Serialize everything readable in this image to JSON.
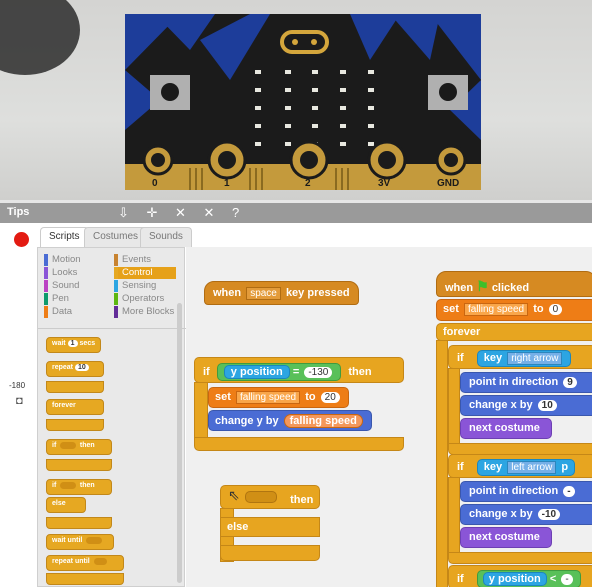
{
  "photo": {
    "board_pins": [
      "0",
      "1",
      "2",
      "3V",
      "GND"
    ],
    "colors": {
      "board_blue": "#1d3d9a",
      "board_black": "#1a1a1a",
      "pad_gold": "#c49a3c",
      "led": "#e8e8e0"
    }
  },
  "toolbar": {
    "tips_label": "Tips",
    "tools_glyphs": "⇩ ✛ ✕ ✕ ?"
  },
  "stage": {
    "coord_label": "-180",
    "camera_glyph": "◘"
  },
  "tabs": [
    {
      "label": "Scripts"
    },
    {
      "label": "Costumes"
    },
    {
      "label": "Sounds"
    }
  ],
  "categories": {
    "left": [
      {
        "label": "Motion",
        "color": "#4a6cd4"
      },
      {
        "label": "Looks",
        "color": "#8a55d7"
      },
      {
        "label": "Sound",
        "color": "#bb42c3"
      },
      {
        "label": "Pen",
        "color": "#0e9a6c"
      },
      {
        "label": "Data",
        "color": "#ee7d16"
      }
    ],
    "right": [
      {
        "label": "Events",
        "color": "#c88330"
      },
      {
        "label": "Control",
        "color": "#e6a822"
      },
      {
        "label": "Sensing",
        "color": "#2ca5e2"
      },
      {
        "label": "Operators",
        "color": "#5cb712"
      },
      {
        "label": "More Blocks",
        "color": "#632d99"
      }
    ]
  },
  "palette_blocks": {
    "wait": "wait",
    "wait_num": "1",
    "wait_unit": "secs",
    "repeat": "repeat",
    "repeat_num": "10",
    "forever": "forever",
    "if1": "if",
    "then1": "then",
    "if2": "if",
    "then2": "then",
    "else": "else",
    "wait_until": "wait until",
    "repeat_until": "repeat until"
  },
  "script": {
    "when_key": {
      "when": "when",
      "key": "space",
      "pressed": "key pressed"
    },
    "if_block": {
      "if": "if",
      "then": "then",
      "reporter": "y position",
      "op": "=",
      "value": "-130",
      "set": "set",
      "var": "falling speed",
      "to": "to",
      "to_value": "20",
      "change": "change y by",
      "by_reporter": "falling speed"
    },
    "if_else": {
      "then": "then",
      "else": "else"
    },
    "flag": {
      "when": "when",
      "clicked": "clicked",
      "set": "set",
      "var": "falling speed",
      "to": "to",
      "to_value": "0",
      "forever": "forever",
      "if": "if",
      "key": "key",
      "key1": "right arrow",
      "key2": "left arrow",
      "pressed": "p",
      "point": "point in direction",
      "dir1": "9",
      "dir2": "-",
      "change_x": "change x by",
      "cx1": "10",
      "cx2": "-10",
      "next": "next costume",
      "ypos": "y position",
      "lt": "<",
      "lt_val": "-"
    }
  }
}
